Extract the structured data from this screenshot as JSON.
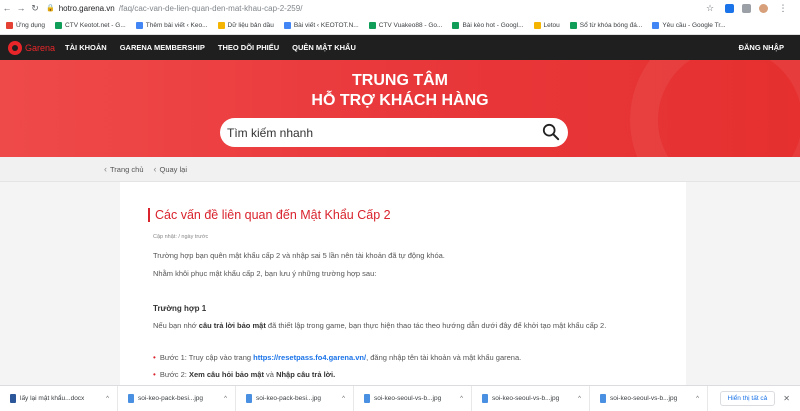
{
  "browser": {
    "url_host": "hotro.garena.vn",
    "url_path": "/faq/cac-van-de-lien-quan-den-mat-khau-cap-2-259/",
    "bookmarks": [
      {
        "label": "Ứng dụng",
        "color": "#e44134"
      },
      {
        "label": "CTV Keotot.net - G...",
        "color": "#0f9d58"
      },
      {
        "label": "Thêm bài viết ‹ Keo...",
        "color": "#4285f4"
      },
      {
        "label": "Dữ liệu bản dầu",
        "color": "#f4b400"
      },
      {
        "label": "Bài viết ‹ KEOTOT.N...",
        "color": "#4285f4"
      },
      {
        "label": "CTV Vuakeo88 - Go...",
        "color": "#0f9d58"
      },
      {
        "label": "Bài kèo hot - Googl...",
        "color": "#0f9d58"
      },
      {
        "label": "Letou",
        "color": "#f4b400"
      },
      {
        "label": "Sổ từ khóa bóng đá...",
        "color": "#0f9d58"
      },
      {
        "label": "Yêu cầu - Google Tr...",
        "color": "#4285f4"
      }
    ]
  },
  "nav": {
    "logo_text": "Garena",
    "items": [
      "TÀI KHOẢN",
      "GARENA MEMBERSHIP",
      "THEO DÕI PHIẾU",
      "QUÊN MẬT KHẨU"
    ],
    "login": "ĐĂNG NHẬP"
  },
  "hero": {
    "title_line1": "TRUNG TÂM",
    "title_line2": "HỖ TRỢ KHÁCH HÀNG",
    "search_placeholder": "Tìm kiếm nhanh"
  },
  "breadcrumb": {
    "home": "Trang chủ",
    "back": "Quay lại"
  },
  "article": {
    "title": "Các vấn đề liên quan đến Mật Khẩu Cấp 2",
    "updated": "Cập nhật: / ngày trước",
    "p1": "Trường hợp bạn quên mật khẩu cấp 2 và nhập sai 5 lần nên tài khoản đã tự động khóa.",
    "p2": "Nhằm khôi phục mật khẩu cấp 2, bạn lưu ý những trường hợp sau:",
    "case_title": "Trường hợp 1",
    "p3_pre": "Nếu bạn nhớ ",
    "p3_bold": "câu trả lời bảo mật",
    "p3_post": " đã thiết lập trong game, bạn thực hiện thao tác theo hướng dẫn dưới đây để khởi tạo mật khẩu cấp 2.",
    "step1_pre": "Bước 1: Truy cập vào trang ",
    "step1_link": "https://resetpass.fo4.garena.vn/",
    "step1_post": ", đăng nhập tên tài khoản và mật khẩu garena.",
    "step2_pre": "Bước 2: ",
    "step2_b1": "Xem câu hỏi bảo mật",
    "step2_mid": " và ",
    "step2_b2": "Nhập câu trả lời."
  },
  "downloads": {
    "items": [
      "lấy lại mật khẩu...docx",
      "soi-keo-pack-besi...jpg",
      "soi-keo-pack-besi...jpg",
      "soi-keo-seoul-vs-b...jpg",
      "soi-keo-seoul-vs-b...jpg",
      "soi-keo-seoul-vs-b...jpg"
    ],
    "show_all": "Hiển thị tất cả"
  }
}
